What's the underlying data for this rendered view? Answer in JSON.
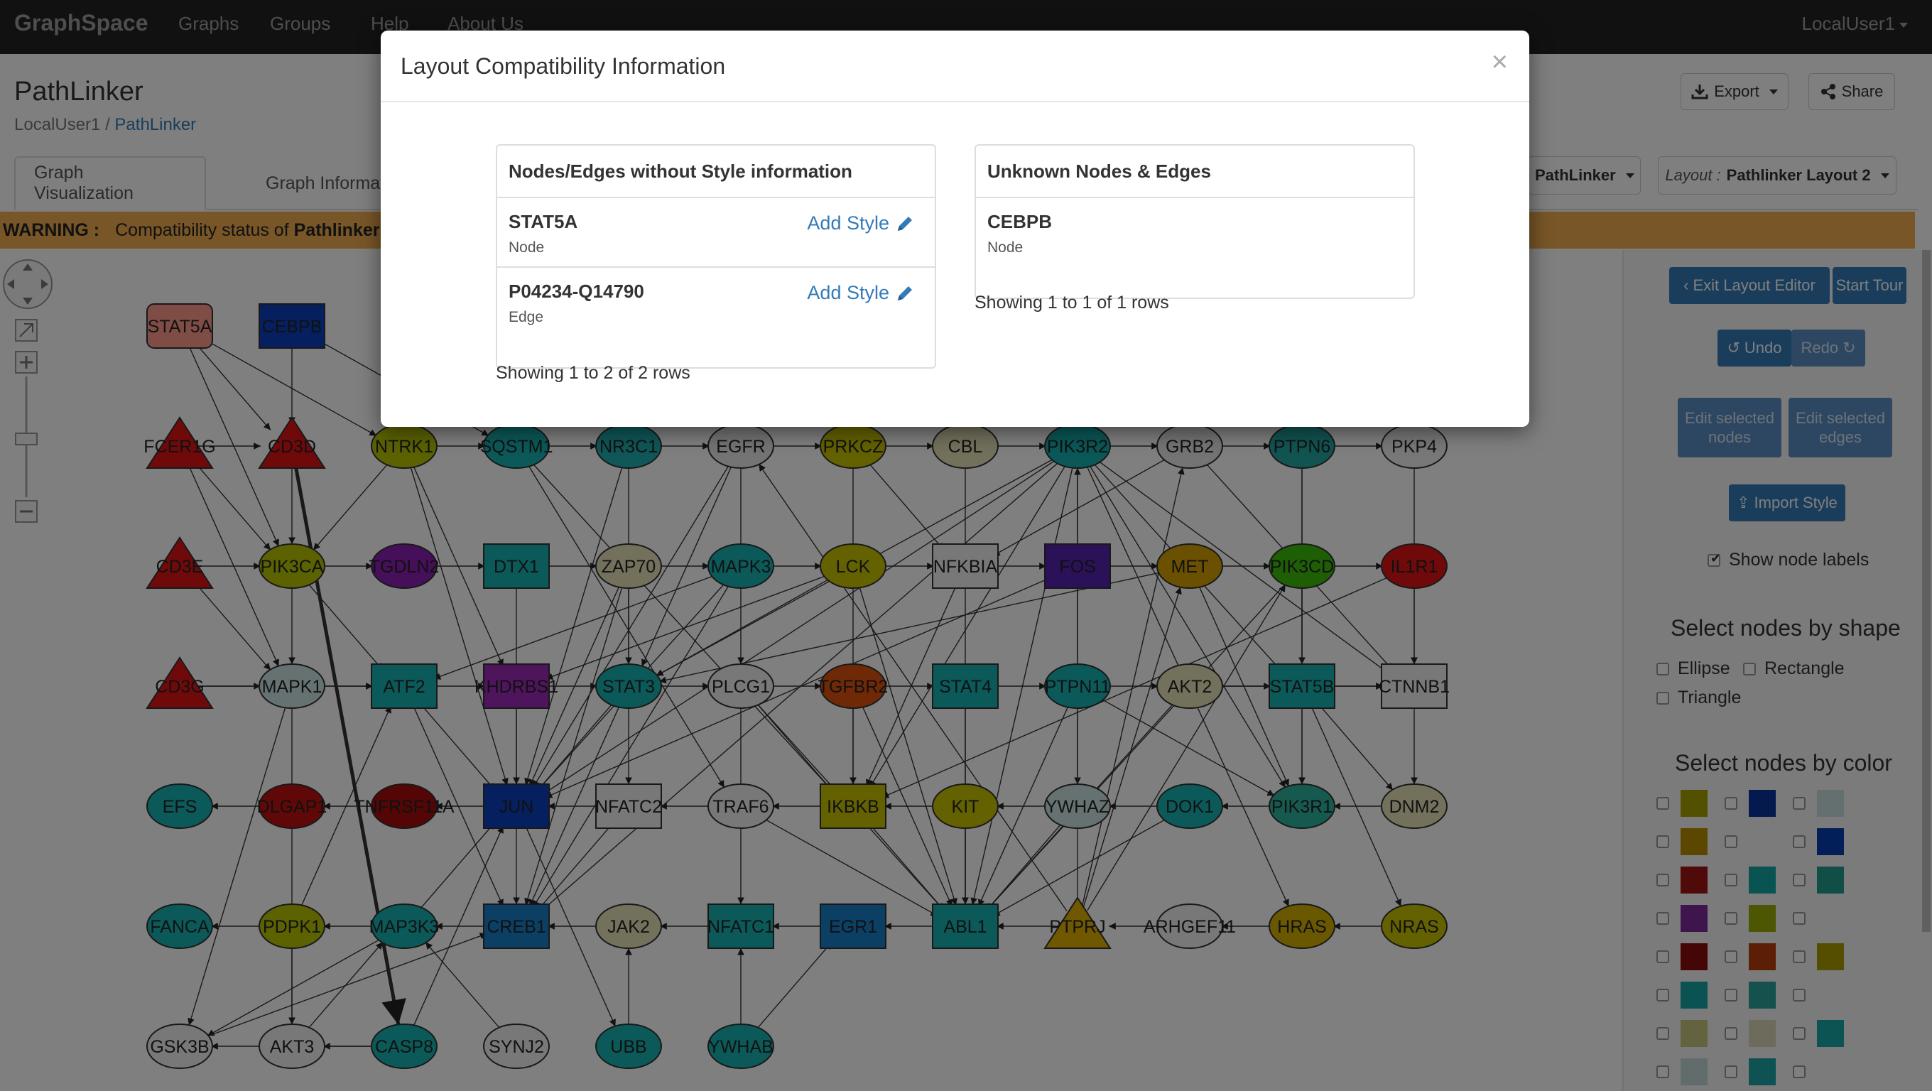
{
  "navbar": {
    "brand": "GraphSpace",
    "items": [
      "Graphs",
      "Groups",
      "Help",
      "About Us"
    ],
    "user": "LocalUser1"
  },
  "header": {
    "title": "PathLinker",
    "breadcrumb_owner": "LocalUser1",
    "breadcrumb_sep": " / ",
    "breadcrumb_graph": "PathLinker",
    "export_label": "Export",
    "share_label": "Share"
  },
  "tabs": [
    "Graph Visualization",
    "Graph Information"
  ],
  "selectors": {
    "style_value": "PathLinker",
    "layout_prefix": "Layout : ",
    "layout_value": "Pathlinker Layout 2"
  },
  "warning": {
    "label": "WARNING :",
    "text": "Compatibility status of ",
    "graph": "Pathlinker"
  },
  "side_panel": {
    "exit_layout_editor": "Exit Layout Editor",
    "start_tour": "Start Tour",
    "undo": "Undo",
    "redo": "Redo",
    "edit_selected_nodes": "Edit selected nodes",
    "edit_selected_edges": "Edit selected edges",
    "import_style": "Import Style",
    "show_node_labels": "Show node labels",
    "shape_heading": "Select nodes by shape",
    "shapes": [
      "Ellipse",
      "Rectangle",
      "Triangle"
    ],
    "color_heading": "Select nodes by color",
    "color_swatches": [
      [
        "#a7a200",
        "#08329c",
        "#c8e0e0"
      ],
      [
        "#b78f00",
        "",
        "#073fb3"
      ],
      [
        "#a31414",
        "#13a8a6",
        "#239c8e"
      ],
      [
        "#7e2a9a",
        "#9bac06",
        ""
      ],
      [
        "#8a0d0d",
        "#b83e0a",
        "#ab9d00"
      ],
      [
        "#17a7a6",
        "#2aa29a",
        ""
      ],
      [
        "#c6c680",
        "#d8d6b8",
        "#16a8a6"
      ],
      [
        "#c5d9da",
        "#1ea5a8",
        ""
      ]
    ]
  },
  "modal": {
    "title": "Layout Compatibility Information",
    "close": "×",
    "left_panel": {
      "heading": "Nodes/Edges without Style information",
      "rows": [
        {
          "name": "STAT5A",
          "type": "Node",
          "action": "Add Style"
        },
        {
          "name": "P04234-Q14790",
          "type": "Edge",
          "action": "Add Style"
        }
      ],
      "showing": "Showing 1 to 2 of 2 rows"
    },
    "right_panel": {
      "heading": "Unknown Nodes & Edges",
      "rows": [
        {
          "name": "CEBPB",
          "type": "Node"
        }
      ],
      "showing": "Showing 1 to 1 of 1 rows"
    }
  },
  "graph": {
    "nodes": [
      {
        "label": "STAT5A",
        "shape": "rect",
        "color": "#ff9a8a",
        "col": 0,
        "row": 0
      },
      {
        "label": "CEBPB",
        "shape": "rect",
        "color": "#0a3fbf",
        "col": 1,
        "row": 0
      },
      {
        "label": "FCER1G",
        "shape": "tri",
        "color": "#e01515",
        "col": 0,
        "row": 1
      },
      {
        "label": "CD3D",
        "shape": "tri",
        "color": "#e01515",
        "col": 1,
        "row": 1
      },
      {
        "label": "NTRK1",
        "shape": "ellipse",
        "color": "#b8c400",
        "col": 2,
        "row": 1
      },
      {
        "label": "SQSTM1",
        "shape": "ellipse",
        "color": "#16b3b3",
        "col": 3,
        "row": 1
      },
      {
        "label": "NR3C1",
        "shape": "ellipse",
        "color": "#1faeb0",
        "col": 4,
        "row": 1
      },
      {
        "label": "EGFR",
        "shape": "ellipse",
        "color": "#e8e8e8",
        "col": 5,
        "row": 1
      },
      {
        "label": "PRKCZ",
        "shape": "ellipse",
        "color": "#c8c200",
        "col": 6,
        "row": 1
      },
      {
        "label": "CBL",
        "shape": "ellipse",
        "color": "#e6e3b8",
        "col": 7,
        "row": 1
      },
      {
        "label": "PIK3R2",
        "shape": "ellipse",
        "color": "#14b1b0",
        "col": 8,
        "row": 1
      },
      {
        "label": "GRB2",
        "shape": "ellipse",
        "color": "#e8e8e8",
        "col": 9,
        "row": 1
      },
      {
        "label": "PTPN6",
        "shape": "ellipse",
        "color": "#22a9a4",
        "col": 10,
        "row": 1
      },
      {
        "label": "PKP4",
        "shape": "ellipse",
        "color": "#f0f0f0",
        "col": 11,
        "row": 1
      },
      {
        "label": "CD3E",
        "shape": "tri",
        "color": "#e01515",
        "col": 0,
        "row": 2
      },
      {
        "label": "PIK3CA",
        "shape": "ellipse",
        "color": "#b8c400",
        "col": 1,
        "row": 2
      },
      {
        "label": "TGDLN2",
        "shape": "ellipse",
        "color": "#8c1fb3",
        "col": 2,
        "row": 2
      },
      {
        "label": "DTX1",
        "shape": "rect",
        "color": "#16b3b3",
        "col": 3,
        "row": 2
      },
      {
        "label": "ZAP70",
        "shape": "ellipse",
        "color": "#e6e3b8",
        "col": 4,
        "row": 2
      },
      {
        "label": "MAPK3",
        "shape": "ellipse",
        "color": "#16b3b3",
        "col": 5,
        "row": 2
      },
      {
        "label": "LCK",
        "shape": "ellipse",
        "color": "#c8c200",
        "col": 6,
        "row": 2
      },
      {
        "label": "NFKBIA",
        "shape": "rect",
        "color": "#f0f0f0",
        "col": 7,
        "row": 2
      },
      {
        "label": "FOS",
        "shape": "rect",
        "color": "#5522b0",
        "col": 8,
        "row": 2
      },
      {
        "label": "MET",
        "shape": "ellipse",
        "color": "#d4a000",
        "col": 9,
        "row": 2
      },
      {
        "label": "PIK3CD",
        "shape": "ellipse",
        "color": "#3dbd0a",
        "col": 10,
        "row": 2
      },
      {
        "label": "IL1R1",
        "shape": "ellipse",
        "color": "#e01515",
        "col": 11,
        "row": 2
      },
      {
        "label": "CD3G",
        "shape": "tri",
        "color": "#e01515",
        "col": 0,
        "row": 3
      },
      {
        "label": "MAPK1",
        "shape": "ellipse",
        "color": "#cde4e4",
        "col": 1,
        "row": 3
      },
      {
        "label": "ATF2",
        "shape": "rect",
        "color": "#16b3b3",
        "col": 2,
        "row": 3
      },
      {
        "label": "KHDRBS1",
        "shape": "rect",
        "color": "#9c2ab8",
        "col": 3,
        "row": 3
      },
      {
        "label": "STAT3",
        "shape": "ellipse",
        "color": "#16b3b3",
        "col": 4,
        "row": 3
      },
      {
        "label": "PLCG1",
        "shape": "ellipse",
        "color": "#f0f0f0",
        "col": 5,
        "row": 3
      },
      {
        "label": "TGFBR2",
        "shape": "ellipse",
        "color": "#e0520c",
        "col": 6,
        "row": 3
      },
      {
        "label": "STAT4",
        "shape": "rect",
        "color": "#16b3b3",
        "col": 7,
        "row": 3
      },
      {
        "label": "PTPN11",
        "shape": "ellipse",
        "color": "#16b3b3",
        "col": 8,
        "row": 3
      },
      {
        "label": "AKT2",
        "shape": "ellipse",
        "color": "#e6e3b8",
        "col": 9,
        "row": 3
      },
      {
        "label": "STAT5B",
        "shape": "rect",
        "color": "#16b3b3",
        "col": 10,
        "row": 3
      },
      {
        "label": "CTNNB1",
        "shape": "rect",
        "color": "#f0f0f0",
        "col": 11,
        "row": 3
      },
      {
        "label": "EFS",
        "shape": "ellipse",
        "color": "#16b3b3",
        "col": 0,
        "row": 4
      },
      {
        "label": "DLGAP1",
        "shape": "ellipse",
        "color": "#c01010",
        "col": 1,
        "row": 4
      },
      {
        "label": "TNFRSF11A",
        "shape": "ellipse",
        "color": "#a80c0c",
        "col": 2,
        "row": 4
      },
      {
        "label": "JUN",
        "shape": "rect",
        "color": "#0a3fbf",
        "col": 3,
        "row": 4
      },
      {
        "label": "NFATC2",
        "shape": "rect",
        "color": "#f0f0f0",
        "col": 4,
        "row": 4
      },
      {
        "label": "TRAF6",
        "shape": "ellipse",
        "color": "#f0f0f0",
        "col": 5,
        "row": 4
      },
      {
        "label": "IKBKB",
        "shape": "rect",
        "color": "#c8c200",
        "col": 6,
        "row": 4
      },
      {
        "label": "KIT",
        "shape": "ellipse",
        "color": "#c8c200",
        "col": 7,
        "row": 4
      },
      {
        "label": "YWHAZ",
        "shape": "ellipse",
        "color": "#cde4e4",
        "col": 8,
        "row": 4
      },
      {
        "label": "DOK1",
        "shape": "ellipse",
        "color": "#16b3b3",
        "col": 9,
        "row": 4
      },
      {
        "label": "PIK3R1",
        "shape": "ellipse",
        "color": "#2cb39e",
        "col": 10,
        "row": 4
      },
      {
        "label": "DNM2",
        "shape": "ellipse",
        "color": "#e6e3b8",
        "col": 11,
        "row": 4
      },
      {
        "label": "FANCA",
        "shape": "ellipse",
        "color": "#16b3b3",
        "col": 0,
        "row": 5
      },
      {
        "label": "PDPK1",
        "shape": "ellipse",
        "color": "#b8c400",
        "col": 1,
        "row": 5
      },
      {
        "label": "MAP3K3",
        "shape": "ellipse",
        "color": "#16b3b3",
        "col": 2,
        "row": 5
      },
      {
        "label": "CREB1",
        "shape": "rect",
        "color": "#1680c8",
        "col": 3,
        "row": 5
      },
      {
        "label": "JAK2",
        "shape": "ellipse",
        "color": "#e6e3b8",
        "col": 4,
        "row": 5
      },
      {
        "label": "NFATC1",
        "shape": "rect",
        "color": "#16b3b3",
        "col": 5,
        "row": 5
      },
      {
        "label": "EGR1",
        "shape": "rect",
        "color": "#1680c8",
        "col": 6,
        "row": 5
      },
      {
        "label": "ABL1",
        "shape": "rect",
        "color": "#16b3b3",
        "col": 7,
        "row": 5
      },
      {
        "label": "PTPRJ",
        "shape": "tri",
        "color": "#e0b000",
        "col": 8,
        "row": 5
      },
      {
        "label": "ARHGEF11",
        "shape": "ellipse",
        "color": "#f0f0f0",
        "col": 9,
        "row": 5
      },
      {
        "label": "HRAS",
        "shape": "ellipse",
        "color": "#d4b000",
        "col": 10,
        "row": 5
      },
      {
        "label": "NRAS",
        "shape": "ellipse",
        "color": "#c8c200",
        "col": 11,
        "row": 5
      },
      {
        "label": "GSK3B",
        "shape": "ellipse",
        "color": "#f0f0f0",
        "col": 0,
        "row": 6
      },
      {
        "label": "AKT3",
        "shape": "ellipse",
        "color": "#f0f0f0",
        "col": 1,
        "row": 6
      },
      {
        "label": "CASP8",
        "shape": "ellipse",
        "color": "#16b3b3",
        "col": 2,
        "row": 6
      },
      {
        "label": "SYNJ2",
        "shape": "ellipse",
        "color": "#f0f0f0",
        "col": 3,
        "row": 6
      },
      {
        "label": "UBB",
        "shape": "ellipse",
        "color": "#16b3b3",
        "col": 4,
        "row": 6
      },
      {
        "label": "YWHAB",
        "shape": "ellipse",
        "color": "#16b3b3",
        "col": 5,
        "row": 6
      }
    ],
    "edges": [
      [
        "STAT5A",
        "CD3D"
      ],
      [
        "STAT5A",
        "NTRK1"
      ],
      [
        "STAT5A",
        "PIK3CA"
      ],
      [
        "CEBPB",
        "CD3D"
      ],
      [
        "CEBPB",
        "SQSTM1"
      ],
      [
        "CD3D",
        "CASP8"
      ],
      [
        "CD3D",
        "PIK3CA"
      ],
      [
        "FCER1G",
        "CD3D"
      ],
      [
        "FCER1G",
        "PIK3CA"
      ],
      [
        "NTRK1",
        "SQSTM1"
      ],
      [
        "SQSTM1",
        "NR3C1"
      ],
      [
        "NR3C1",
        "EGFR"
      ],
      [
        "EGFR",
        "PRKCZ"
      ],
      [
        "PRKCZ",
        "CBL"
      ],
      [
        "CBL",
        "PIK3R2"
      ],
      [
        "PIK3R2",
        "GRB2"
      ],
      [
        "GRB2",
        "PTPN6"
      ],
      [
        "PTPN6",
        "PKP4"
      ],
      [
        "PKP4",
        "CTNNB1"
      ],
      [
        "IL1R1",
        "CTNNB1"
      ],
      [
        "CD3E",
        "PIK3CA"
      ],
      [
        "PIK3CA",
        "TGDLN2"
      ],
      [
        "TGDLN2",
        "DTX1"
      ],
      [
        "DTX1",
        "ZAP70"
      ],
      [
        "ZAP70",
        "MAPK3"
      ],
      [
        "MAPK3",
        "LCK"
      ],
      [
        "LCK",
        "NFKBIA"
      ],
      [
        "NFKBIA",
        "FOS"
      ],
      [
        "FOS",
        "MET"
      ],
      [
        "MET",
        "PIK3CD"
      ],
      [
        "PIK3CD",
        "IL1R1"
      ],
      [
        "CD3G",
        "MAPK1"
      ],
      [
        "MAPK1",
        "ATF2"
      ],
      [
        "ATF2",
        "KHDRBS1"
      ],
      [
        "KHDRBS1",
        "STAT3"
      ],
      [
        "STAT3",
        "PLCG1"
      ],
      [
        "PLCG1",
        "TGFBR2"
      ],
      [
        "TGFBR2",
        "STAT4"
      ],
      [
        "STAT4",
        "PTPN11"
      ],
      [
        "PTPN11",
        "AKT2"
      ],
      [
        "AKT2",
        "STAT5B"
      ],
      [
        "STAT5B",
        "CTNNB1"
      ],
      [
        "DLGAP1",
        "EFS"
      ],
      [
        "TNFRSF11A",
        "DLGAP1"
      ],
      [
        "JUN",
        "TNFRSF11A"
      ],
      [
        "NFATC2",
        "JUN"
      ],
      [
        "TRAF6",
        "NFATC2"
      ],
      [
        "IKBKB",
        "TRAF6"
      ],
      [
        "KIT",
        "IKBKB"
      ],
      [
        "YWHAZ",
        "KIT"
      ],
      [
        "DOK1",
        "YWHAZ"
      ],
      [
        "PIK3R1",
        "DOK1"
      ],
      [
        "DNM2",
        "PIK3R1"
      ],
      [
        "PDPK1",
        "FANCA"
      ],
      [
        "MAP3K3",
        "PDPK1"
      ],
      [
        "CREB1",
        "MAP3K3"
      ],
      [
        "JAK2",
        "CREB1"
      ],
      [
        "NFATC1",
        "JAK2"
      ],
      [
        "EGR1",
        "NFATC1"
      ],
      [
        "ABL1",
        "EGR1"
      ],
      [
        "PTPRJ",
        "ABL1"
      ],
      [
        "ARHGEF11",
        "PTPRJ"
      ],
      [
        "HRAS",
        "ARHGEF11"
      ],
      [
        "NRAS",
        "HRAS"
      ],
      [
        "MAPK1",
        "GSK3B"
      ],
      [
        "MAPK1",
        "AKT3"
      ],
      [
        "PDPK1",
        "AKT3"
      ],
      [
        "MAP3K3",
        "GSK3B"
      ],
      [
        "CASP8",
        "JUN"
      ],
      [
        "PIK3R2",
        "ABL1"
      ],
      [
        "PIK3R2",
        "PIK3R1"
      ],
      [
        "PIK3R2",
        "STAT3"
      ],
      [
        "PIK3R2",
        "JUN"
      ],
      [
        "PIK3R2",
        "CREB1"
      ],
      [
        "PIK3R2",
        "IKBKB"
      ],
      [
        "PIK3R2",
        "CTNNB1"
      ],
      [
        "PIK3R2",
        "STAT5B"
      ],
      [
        "PIK3R2",
        "YWHAZ"
      ],
      [
        "PIK3R2",
        "HRAS"
      ],
      [
        "GRB2",
        "CTNNB1"
      ],
      [
        "GRB2",
        "NFKBIA"
      ],
      [
        "PTPN6",
        "STAT5B"
      ],
      [
        "PTPN6",
        "PIK3R1"
      ],
      [
        "CBL",
        "ABL1"
      ],
      [
        "EGFR",
        "JUN"
      ],
      [
        "EGFR",
        "STAT3"
      ],
      [
        "EGFR",
        "PLCG1"
      ],
      [
        "PRKCZ",
        "IKBKB"
      ],
      [
        "PRKCZ",
        "NFKBIA"
      ],
      [
        "LCK",
        "STAT3"
      ],
      [
        "LCK",
        "ABL1"
      ],
      [
        "LCK",
        "KHDRBS1"
      ],
      [
        "ZAP70",
        "JUN"
      ],
      [
        "ZAP70",
        "NFATC2"
      ],
      [
        "PLCG1",
        "IKBKB"
      ],
      [
        "PLCG1",
        "ABL1"
      ],
      [
        "PLCG1",
        "NFATC1"
      ],
      [
        "STAT3",
        "JUN"
      ],
      [
        "STAT3",
        "CREB1"
      ],
      [
        "MAPK3",
        "JUN"
      ],
      [
        "MAPK3",
        "ATF2"
      ],
      [
        "MAPK3",
        "CREB1"
      ],
      [
        "FOS",
        "JUN"
      ],
      [
        "NFKBIA",
        "IKBKB"
      ],
      [
        "MET",
        "PIK3R1"
      ],
      [
        "MET",
        "STAT3"
      ],
      [
        "PIK3CD",
        "PIK3R1"
      ],
      [
        "PIK3CD",
        "ABL1"
      ],
      [
        "IL1R1",
        "IKBKB"
      ],
      [
        "TGFBR2",
        "IKBKB"
      ],
      [
        "TGFBR2",
        "ABL1"
      ],
      [
        "STAT4",
        "ABL1"
      ],
      [
        "PTPN11",
        "ABL1"
      ],
      [
        "PTPN11",
        "PIK3R1"
      ],
      [
        "AKT2",
        "ABL1"
      ],
      [
        "AKT2",
        "CTNNB1"
      ],
      [
        "STAT5B",
        "DNM2"
      ],
      [
        "STAT5B",
        "NRAS"
      ],
      [
        "CTNNB1",
        "DNM2"
      ],
      [
        "PTPRJ",
        "PIK3R2"
      ],
      [
        "PTPRJ",
        "MET"
      ],
      [
        "PTPRJ",
        "PIK3CD"
      ],
      [
        "PTPRJ",
        "GRB2"
      ],
      [
        "PTPRJ",
        "EGFR"
      ],
      [
        "KIT",
        "ABL1"
      ],
      [
        "YWHAZ",
        "ABL1"
      ],
      [
        "DOK1",
        "ABL1"
      ],
      [
        "IKBKB",
        "ABL1"
      ],
      [
        "TRAF6",
        "ABL1"
      ],
      [
        "JUN",
        "UBB"
      ],
      [
        "JUN",
        "CREB1"
      ],
      [
        "NFATC2",
        "CREB1"
      ],
      [
        "UBB",
        "JAK2"
      ],
      [
        "YWHAB",
        "NFATC1"
      ],
      [
        "YWHAB",
        "EGR1"
      ],
      [
        "SYNJ2",
        "MAP3K3"
      ],
      [
        "AKT3",
        "MAP3K3"
      ],
      [
        "GSK3B",
        "CREB1"
      ],
      [
        "CASP8",
        "AKT3"
      ],
      [
        "CASP8",
        "GSK3B"
      ],
      [
        "PDPK1",
        "ATF2"
      ],
      [
        "PIK3CA",
        "ATF2"
      ],
      [
        "PIK3CA",
        "MAPK1"
      ],
      [
        "CD3E",
        "MAPK1"
      ],
      [
        "CD3G",
        "ATF2"
      ],
      [
        "FCER1G",
        "MAPK1"
      ],
      [
        "NTRK1",
        "JUN"
      ],
      [
        "NTRK1",
        "PIK3CA"
      ],
      [
        "NR3C1",
        "JUN"
      ],
      [
        "NR3C1",
        "STAT3"
      ],
      [
        "SQSTM1",
        "TRAF6"
      ],
      [
        "SQSTM1",
        "IKBKB"
      ],
      [
        "NTRK1",
        "KHDRBS1"
      ],
      [
        "ZAP70",
        "CREB1"
      ],
      [
        "KHDRBS1",
        "JUN"
      ],
      [
        "ATF2",
        "JUN"
      ],
      [
        "ATF2",
        "CREB1"
      ],
      [
        "MAP3K3",
        "JUN"
      ],
      [
        "DTX1",
        "JUN"
      ]
    ]
  }
}
